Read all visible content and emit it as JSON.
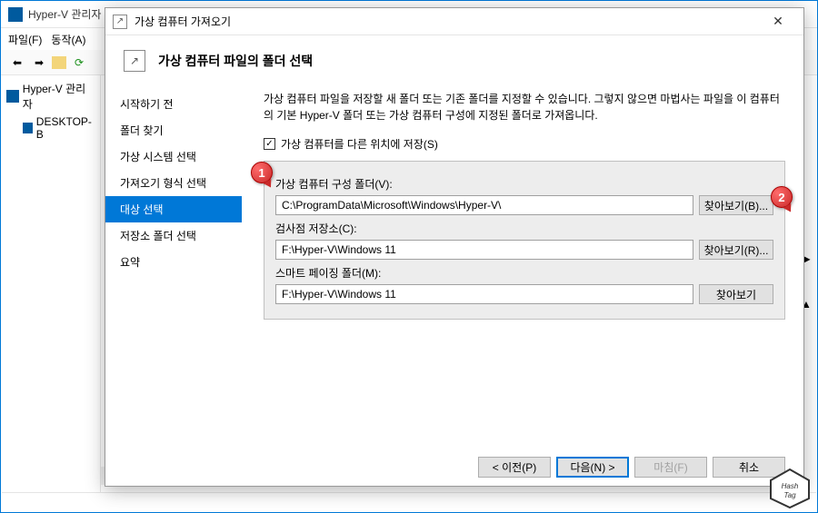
{
  "parent": {
    "title": "Hyper-V 관리자",
    "menu": {
      "file": "파일(F)",
      "action": "동작(A)"
    },
    "tree": {
      "root": "Hyper-V 관리자",
      "node": "DESKTOP-B"
    }
  },
  "wizard": {
    "title": "가상 컴퓨터 가져오기",
    "header": "가상 컴퓨터 파일의 폴더 선택",
    "steps": [
      "시작하기 전",
      "폴더 찾기",
      "가상 시스템 선택",
      "가져오기 형식 선택",
      "대상 선택",
      "저장소 폴더 선택",
      "요약"
    ],
    "description": "가상 컴퓨터 파일을 저장할 새 폴더 또는 기존 폴더를 지정할 수 있습니다. 그렇지 않으면 마법사는 파일을 이 컴퓨터의 기본 Hyper-V 폴더 또는 가상 컴퓨터 구성에 지정된 폴더로 가져옵니다.",
    "checkbox_label": "가상 컴퓨터를 다른 위치에 저장(S)",
    "checkbox_checked": "✓",
    "fields": {
      "config_label": "가상 컴퓨터 구성 폴더(V):",
      "config_value": "C:\\ProgramData\\Microsoft\\Windows\\Hyper-V\\",
      "config_browse": "찾아보기(B)...",
      "checkpoint_label": "검사점 저장소(C):",
      "checkpoint_value": "F:\\Hyper-V\\Windows 11",
      "checkpoint_browse": "찾아보기(R)...",
      "paging_label": "스마트 페이징 폴더(M):",
      "paging_value": "F:\\Hyper-V\\Windows 11",
      "paging_browse": "찾아보기"
    },
    "buttons": {
      "prev": "< 이전(P)",
      "next": "다음(N) >",
      "finish": "마침(F)",
      "cancel": "취소"
    }
  },
  "callouts": {
    "one": "1",
    "two": "2"
  },
  "logo": "Hash Tag"
}
